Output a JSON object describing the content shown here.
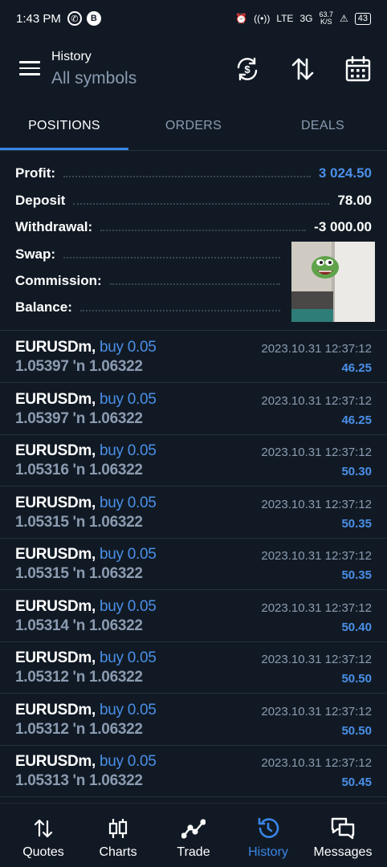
{
  "status_bar": {
    "time": "1:43 PM",
    "net_speed": "63.7",
    "net_unit": "K/S",
    "battery": "43",
    "signal1": "LTE",
    "signal2": "3G"
  },
  "header": {
    "title": "History",
    "subtitle": "All symbols"
  },
  "tabs": [
    {
      "label": "POSITIONS",
      "active": true
    },
    {
      "label": "ORDERS",
      "active": false
    },
    {
      "label": "DEALS",
      "active": false
    }
  ],
  "summary": {
    "profit": {
      "label": "Profit:",
      "value": "3 024.50"
    },
    "deposit": {
      "label": "Deposit",
      "value": "78.00"
    },
    "withdrawal": {
      "label": "Withdrawal:",
      "value": "-3 000.00"
    },
    "swap": {
      "label": "Swap:",
      "value": ""
    },
    "commission": {
      "label": "Commission:",
      "value": ""
    },
    "balance": {
      "label": "Balance:",
      "value": ""
    }
  },
  "deals": [
    {
      "symbol": "EURUSDm,",
      "side": "buy 0.05",
      "prices": "1.05397 'n  1.06322",
      "time": "2023.10.31 12:37:12",
      "profit": "46.25"
    },
    {
      "symbol": "EURUSDm,",
      "side": "buy 0.05",
      "prices": "1.05397 'n  1.06322",
      "time": "2023.10.31 12:37:12",
      "profit": "46.25"
    },
    {
      "symbol": "EURUSDm,",
      "side": "buy 0.05",
      "prices": "1.05316 'n  1.06322",
      "time": "2023.10.31 12:37:12",
      "profit": "50.30"
    },
    {
      "symbol": "EURUSDm,",
      "side": "buy 0.05",
      "prices": "1.05315 'n  1.06322",
      "time": "2023.10.31 12:37:12",
      "profit": "50.35"
    },
    {
      "symbol": "EURUSDm,",
      "side": "buy 0.05",
      "prices": "1.05315 'n  1.06322",
      "time": "2023.10.31 12:37:12",
      "profit": "50.35"
    },
    {
      "symbol": "EURUSDm,",
      "side": "buy 0.05",
      "prices": "1.05314 'n  1.06322",
      "time": "2023.10.31 12:37:12",
      "profit": "50.40"
    },
    {
      "symbol": "EURUSDm,",
      "side": "buy 0.05",
      "prices": "1.05312 'n  1.06322",
      "time": "2023.10.31 12:37:12",
      "profit": "50.50"
    },
    {
      "symbol": "EURUSDm,",
      "side": "buy 0.05",
      "prices": "1.05312 'n  1.06322",
      "time": "2023.10.31 12:37:12",
      "profit": "50.50"
    },
    {
      "symbol": "EURUSDm,",
      "side": "buy 0.05",
      "prices": "1.05313 'n  1.06322",
      "time": "2023.10.31 12:37:12",
      "profit": "50.45"
    }
  ],
  "bottom_nav": [
    {
      "label": "Quotes",
      "icon": "quotes-icon",
      "active": false
    },
    {
      "label": "Charts",
      "icon": "charts-icon",
      "active": false
    },
    {
      "label": "Trade",
      "icon": "trade-icon",
      "active": false
    },
    {
      "label": "History",
      "icon": "history-icon",
      "active": true
    },
    {
      "label": "Messages",
      "icon": "messages-icon",
      "active": false
    }
  ],
  "colors": {
    "background": "#111a24",
    "accent": "#3a86e8",
    "muted": "#8b9bb1",
    "profit": "#4a8fe8"
  }
}
